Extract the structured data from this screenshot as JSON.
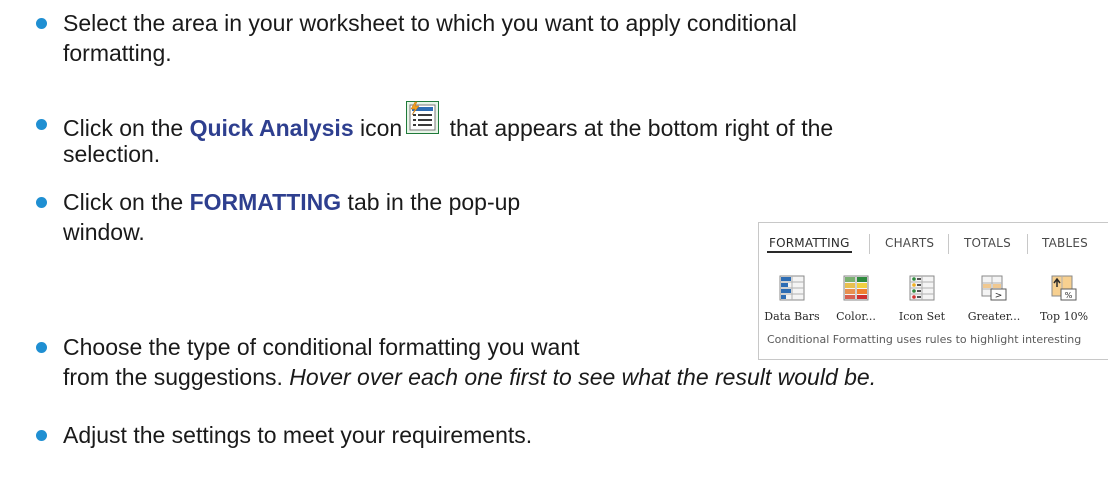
{
  "steps": [
    {
      "line1": "Select the area in your worksheet to which you want to apply conditional",
      "line2": "formatting."
    },
    {
      "pre": "Click on the ",
      "keyword": "Quick Analysis",
      "mid": " icon",
      "post": " that appears at the bottom right of the",
      "line2": "selection."
    },
    {
      "pre": "Click on the ",
      "keyword": "FORMATTING",
      "post": " tab in the pop-up",
      "line2": "window."
    },
    {
      "line1": "Choose the type of conditional formatting you want",
      "line2_plain": "from the suggestions. ",
      "line2_italic": "Hover over each one first to see what the result would be."
    },
    {
      "line1": "Adjust the settings to meet your requirements."
    }
  ],
  "quick_analysis": {
    "tabs": [
      "FORMATTING",
      "CHARTS",
      "TOTALS",
      "TABLES"
    ],
    "active_tab": "FORMATTING",
    "items": [
      {
        "label": "Data Bars",
        "icon": "data-bars-icon"
      },
      {
        "label": "Color...",
        "icon": "color-scale-icon"
      },
      {
        "label": "Icon Set",
        "icon": "icon-set-icon"
      },
      {
        "label": "Greater...",
        "icon": "greater-than-icon"
      },
      {
        "label": "Top 10%",
        "icon": "top-10-percent-icon"
      }
    ],
    "footer": "Conditional Formatting uses rules to highlight interesting"
  },
  "colors": {
    "bullet": "#1f8fd2",
    "keyword": "#2e3f8f",
    "text": "#1a1a1a"
  }
}
